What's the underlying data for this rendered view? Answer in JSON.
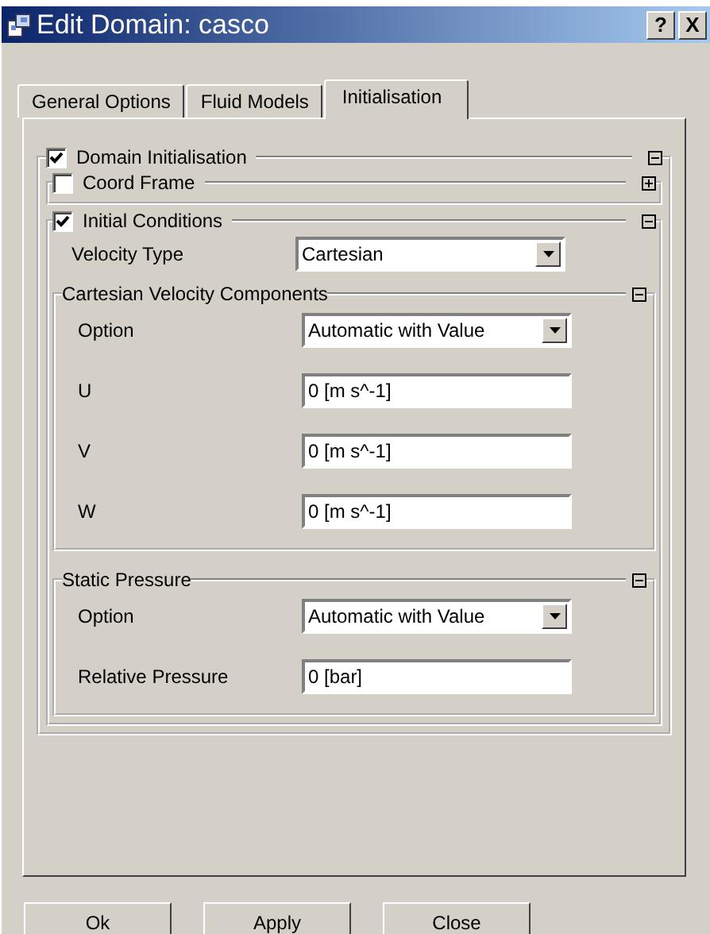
{
  "window": {
    "title": "Edit Domain: casco",
    "buttons": [
      "?",
      "X"
    ]
  },
  "tabs": [
    {
      "label": "General Options",
      "selected": false
    },
    {
      "label": "Fluid Models",
      "selected": false
    },
    {
      "label": "Initialisation",
      "selected": true
    }
  ],
  "groups": [
    {
      "label": "Domain Initialisation",
      "checked": true,
      "expanded": true,
      "children": [
        {
          "label": "Coord Frame",
          "checked": false,
          "expanded": false
        },
        {
          "label": "Initial Conditions",
          "checked": true,
          "expanded": true,
          "fields": [
            {
              "label": "Velocity Type",
              "kind": "select",
              "value": "Cartesian"
            }
          ],
          "children": [
            {
              "label": "Cartesian Velocity Components",
              "expanded": true,
              "fields": [
                {
                  "label": "Option",
                  "kind": "select",
                  "value": "Automatic with Value"
                },
                {
                  "label": "U",
                  "kind": "text",
                  "value": "0 [m s^-1]"
                },
                {
                  "label": "V",
                  "kind": "text",
                  "value": "0 [m s^-1]"
                },
                {
                  "label": "W",
                  "kind": "text",
                  "value": "0 [m s^-1]"
                }
              ]
            },
            {
              "label": "Static Pressure",
              "expanded": true,
              "fields": [
                {
                  "label": "Option",
                  "kind": "select",
                  "value": "Automatic with Value"
                },
                {
                  "label": "Relative Pressure",
                  "kind": "text",
                  "value": "0 [bar]"
                }
              ]
            }
          ]
        }
      ]
    }
  ],
  "buttons": [
    "Ok",
    "Apply",
    "Close"
  ]
}
